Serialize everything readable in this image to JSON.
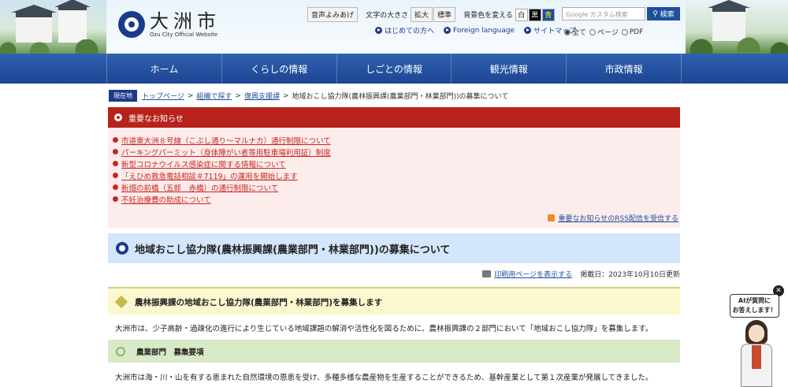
{
  "header": {
    "city_name": "大洲市",
    "city_sub": "Ozu City Official Website",
    "voice_button": "音声よみあげ",
    "font_size_label": "文字の大きさ",
    "font_enlarge": "拡大",
    "font_standard": "標準",
    "bg_color_label": "背景色を変える",
    "bg_white": "白",
    "bg_black": "黒",
    "bg_blue": "青",
    "links": [
      "はじめての方へ",
      "Foreign language",
      "サイトマップ"
    ],
    "search_placeholder": "Google カスタム検索",
    "search_button": "検索",
    "search_scope": [
      "全て",
      "ページ",
      "PDF"
    ]
  },
  "nav": [
    "ホーム",
    "くらしの情報",
    "しごとの情報",
    "観光情報",
    "市政情報"
  ],
  "breadcrumb": {
    "label": "現在地",
    "items": [
      "トップページ",
      "組織で探す",
      "復興支援課"
    ],
    "current": "地域おこし協力隊(農林振興課(農業部門・林業部門))の募集について"
  },
  "notice": {
    "title": "重要なお知らせ",
    "items": [
      "市道東大洲８号線（こぶし通り～マルナカ）通行制限について",
      "パーキングパーミット（身体障がい者等用駐車場利用証）制度",
      "新型コロナウイルス感染症に関する情報について",
      "「えひめ救急電話相談＃7119」の運用を開始します",
      "新畑の前橋（五郎　赤橋）の通行制限について",
      "不妊治療費の助成について"
    ],
    "rss": "重要なお知らせのRSS配信を受信する"
  },
  "page": {
    "title": "地域おこし協力隊(農林振興課(農業部門・林業部門))の募集について",
    "print_link": "印刷用ページを表示する",
    "posted": "掲載日：2023年10月10日更新",
    "section1": "農林振興課の地域おこし協力隊(農業部門・林業部門)を募集します",
    "para1": "大洲市は、少子高齢・過疎化の進行により生じている地域課題の解消や活性化を図るために、農林振興課の２部門において「地域おこし協力隊」を募集します。",
    "section2": "農業部門　募集要項",
    "para2": "大洲市は海・川・山を有する恵まれた自然環境の恩恵を受け、多種多様な農産物を生産することができるため、基幹産業として第１次産業が発展してきました。"
  },
  "assistant": {
    "bubble_line1": "AIが質問に",
    "bubble_line2": "お答えします！",
    "close": "✕"
  }
}
